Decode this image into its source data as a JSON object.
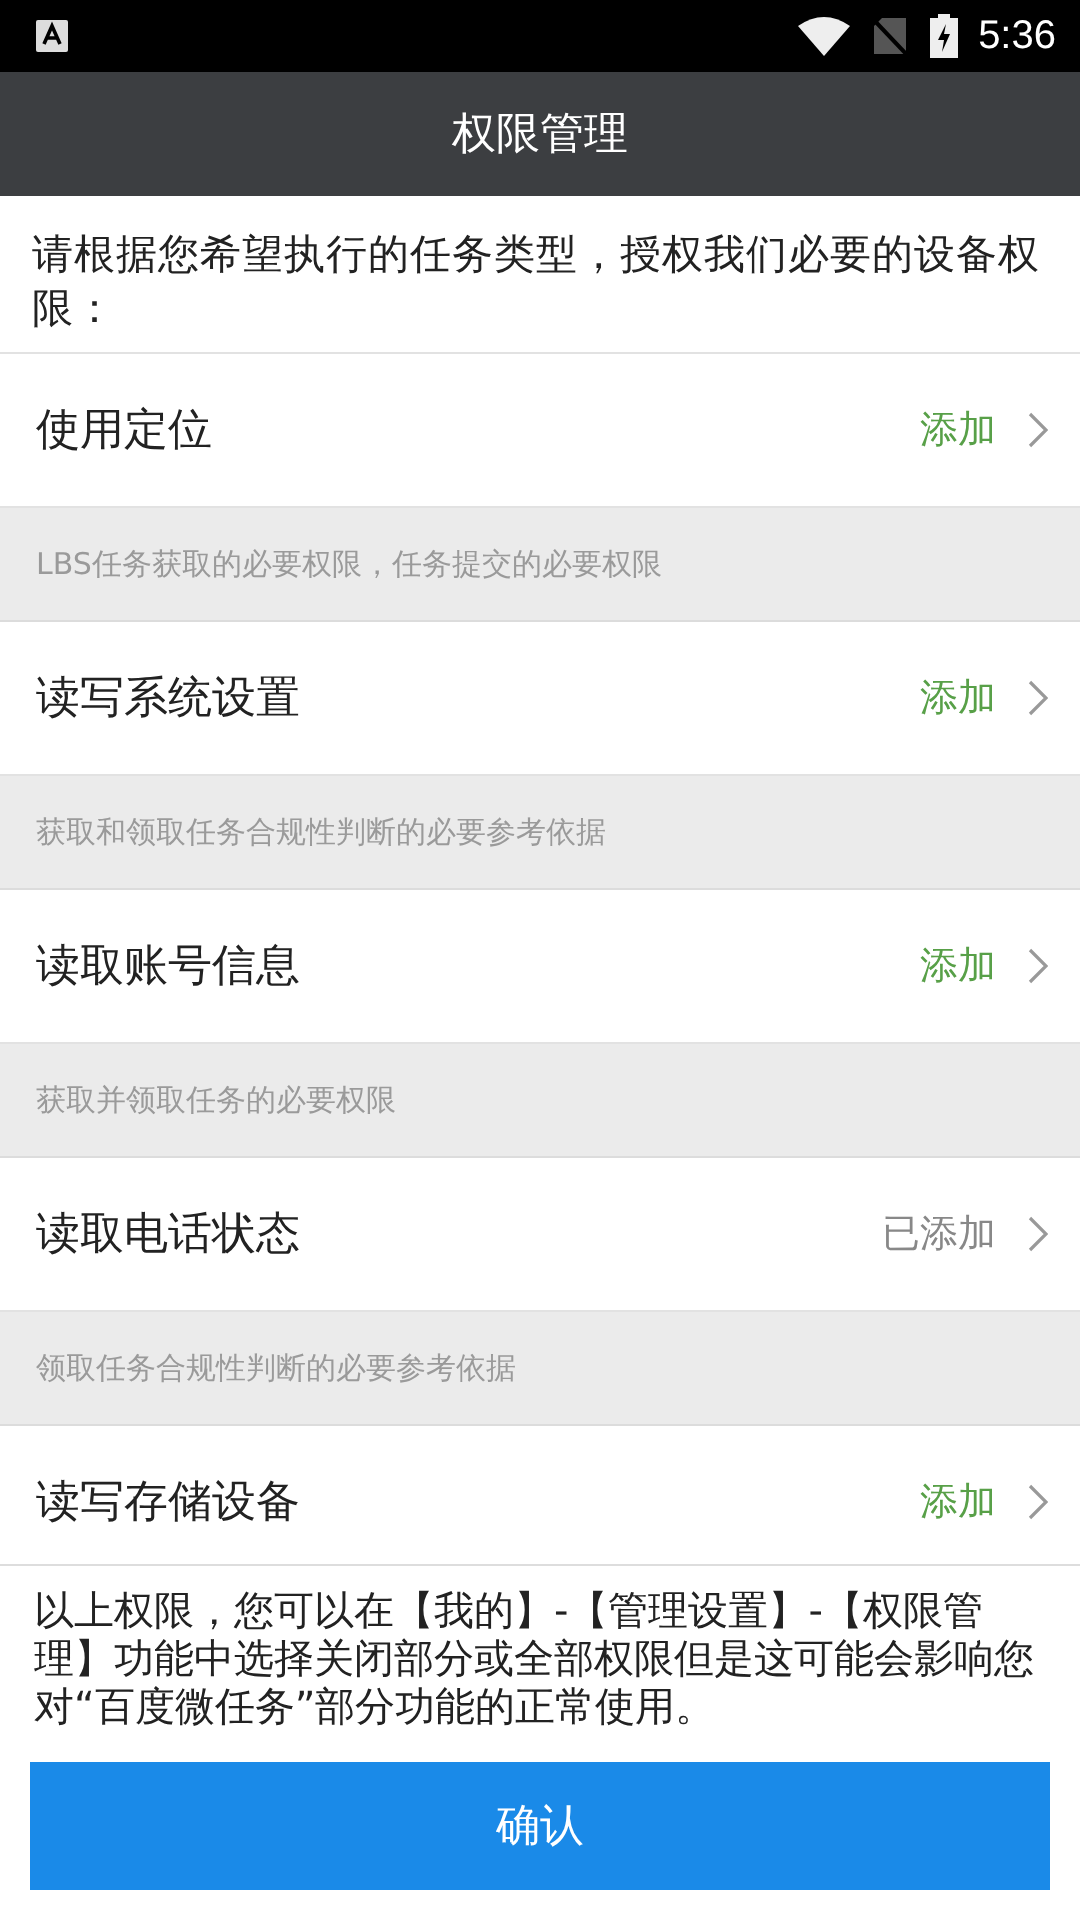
{
  "status_bar": {
    "time": "5:36"
  },
  "header": {
    "title": "权限管理"
  },
  "intro": "请根据您希望执行的任务类型，授权我们必要的设备权限：",
  "permissions": [
    {
      "name": "使用定位",
      "action": "添加",
      "added": false,
      "description": "LBS任务获取的必要权限，任务提交的必要权限"
    },
    {
      "name": "读写系统设置",
      "action": "添加",
      "added": false,
      "description": "获取和领取任务合规性判断的必要参考依据"
    },
    {
      "name": "读取账号信息",
      "action": "添加",
      "added": false,
      "description": "获取并领取任务的必要权限"
    },
    {
      "name": "读取电话状态",
      "action": "已添加",
      "added": true,
      "description": "领取任务合规性判断的必要参考依据"
    },
    {
      "name": "读写存储设备",
      "action": "添加",
      "added": false
    }
  ],
  "footer": {
    "note": "以上权限，您可以在【我的】-【管理设置】-【权限管理】功能中选择关闭部分或全部权限但是这可能会影响您对“百度微任务”部分功能的正常使用。",
    "confirm_button": "确认"
  }
}
